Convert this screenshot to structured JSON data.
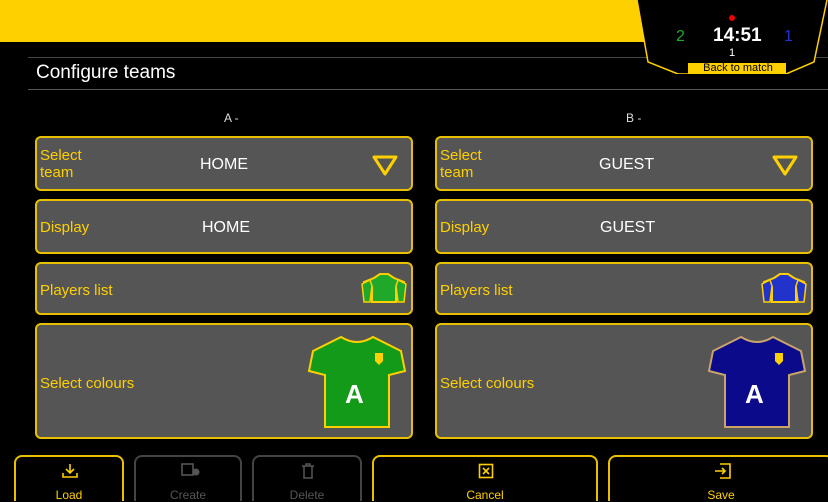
{
  "page": {
    "title": "Configure teams"
  },
  "scoreboard": {
    "home_score": "2",
    "clock": "14:51",
    "period": "1",
    "guest_score": "1",
    "back_label": "Back to match"
  },
  "columns": {
    "a_header": "A -",
    "b_header": "B -"
  },
  "team_a": {
    "select_label": "Select\nteam",
    "team_name": "HOME",
    "display_label": "Display",
    "display_value": "HOME",
    "players_label": "Players list",
    "colours_label": "Select colours",
    "shirt_letter": "A",
    "shirt_color": "#139a18"
  },
  "team_b": {
    "select_label": "Select\nteam",
    "team_name": "GUEST",
    "display_label": "Display",
    "display_value": "GUEST",
    "players_label": "Players list",
    "colours_label": "Select colours",
    "shirt_letter": "A",
    "shirt_color": "#0a0a8a"
  },
  "toolbar": {
    "load": "Load",
    "create": "Create",
    "delete": "Delete",
    "cancel": "Cancel",
    "save": "Save"
  },
  "colors": {
    "accent": "#ffd000",
    "panel": "#555555",
    "home_green": "#1fa82a",
    "guest_blue": "#2233cc"
  },
  "icons": [
    "chevron-down-icon",
    "players-shirts-icon",
    "shirt-icon",
    "download-icon",
    "create-icon",
    "trash-icon",
    "close-box-icon",
    "save-arrow-icon"
  ]
}
